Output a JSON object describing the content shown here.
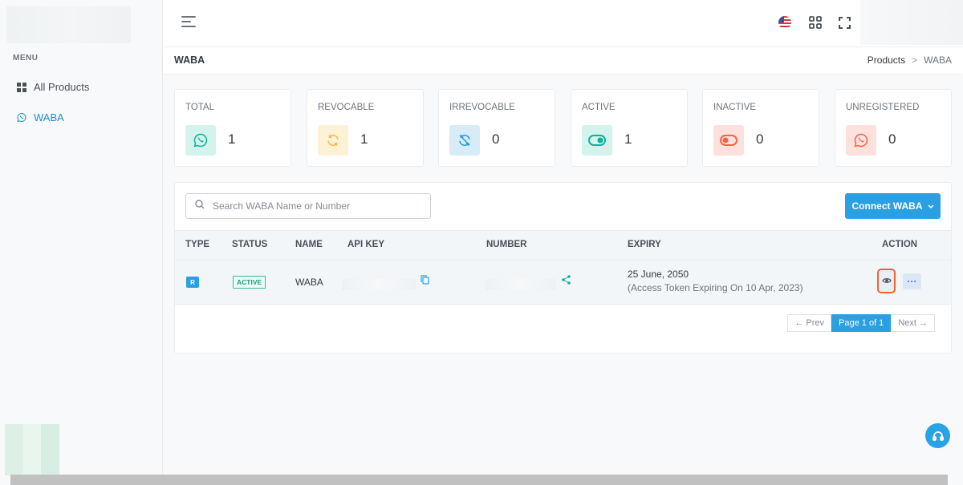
{
  "sidebar": {
    "menu_title": "MENU",
    "items": [
      {
        "label": "All Products",
        "icon": "grid-icon",
        "active": false
      },
      {
        "label": "WABA",
        "icon": "whatsapp-icon",
        "active": true
      }
    ]
  },
  "topbar": {
    "icons": [
      "hamburger-icon",
      "us-flag-icon",
      "apps-grid-icon",
      "fullscreen-icon"
    ]
  },
  "page": {
    "title": "WABA",
    "breadcrumb": {
      "parent": "Products",
      "separator": ">",
      "current": "WABA"
    }
  },
  "stats": [
    {
      "label": "TOTAL",
      "value": "1",
      "icon": "whatsapp-icon",
      "color": "#0ab39c",
      "bg": "#d4f3ec"
    },
    {
      "label": "REVOCABLE",
      "value": "1",
      "icon": "refresh-icon",
      "color": "#f7b84b",
      "bg": "#fdf1d6"
    },
    {
      "label": "IRREVOCABLE",
      "value": "0",
      "icon": "no-refresh-icon",
      "color": "#299cdb",
      "bg": "#d8ecf8"
    },
    {
      "label": "ACTIVE",
      "value": "1",
      "icon": "toggle-on-icon",
      "color": "#0ab39c",
      "bg": "#d4f3ec"
    },
    {
      "label": "INACTIVE",
      "value": "0",
      "icon": "toggle-off-icon",
      "color": "#f06548",
      "bg": "#fde1dc"
    },
    {
      "label": "UNREGISTERED",
      "value": "0",
      "icon": "whatsapp-icon",
      "color": "#f06548",
      "bg": "#fde1dc"
    }
  ],
  "table": {
    "search_placeholder": "Search WABA Name or Number",
    "connect_label": "Connect WABA",
    "headers": [
      "TYPE",
      "STATUS",
      "NAME",
      "API KEY",
      "NUMBER",
      "EXPIRY",
      "ACTION"
    ],
    "rows": [
      {
        "type": "R",
        "status": "ACTIVE",
        "name": "WABA",
        "expiry_date": "25 June, 2050",
        "expiry_note": "(Access Token Expiring On 10 Apr, 2023)",
        "more": "···"
      }
    ],
    "pagination": {
      "prev": "← Prev",
      "current": "Page 1 of 1",
      "next": "Next →"
    }
  },
  "colors": {
    "accent": "#2a9fe2",
    "highlight": "#f1662f"
  }
}
